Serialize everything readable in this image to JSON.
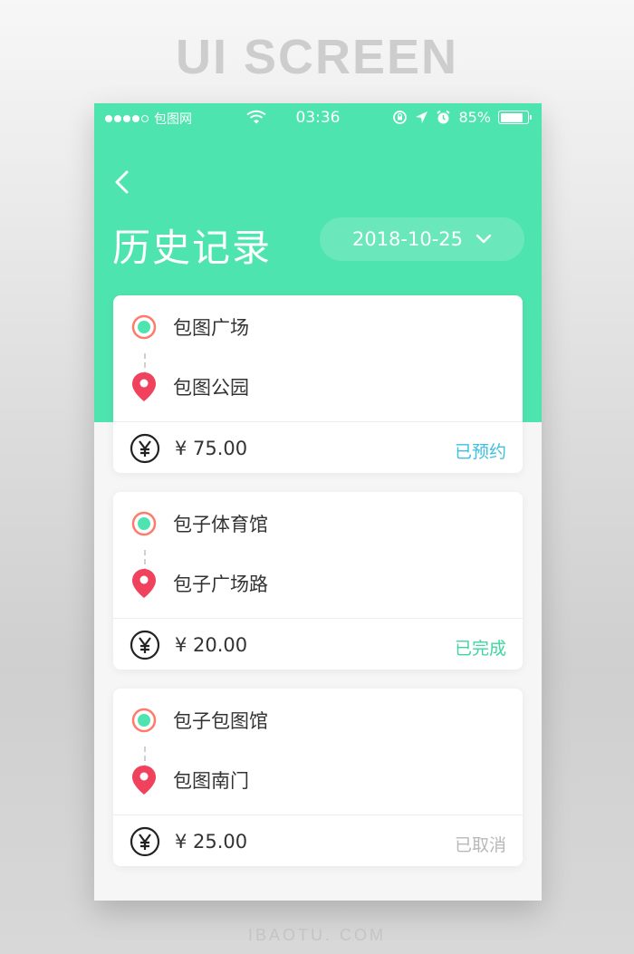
{
  "showcase": {
    "title": "UI SCREEN",
    "footer": "IBAOTU. COM"
  },
  "status_bar": {
    "carrier": "包图网",
    "time": "03:36",
    "battery": "85%",
    "battery_level": 0.85
  },
  "header": {
    "title": "历史记录",
    "date": "2018-10-25"
  },
  "trips": [
    {
      "from": "包图广场",
      "to": "包图公园",
      "price": "¥ 75.00",
      "status": "已预约",
      "status_color": "#3dbfe0"
    },
    {
      "from": "包子体育馆",
      "to": "包子广场路",
      "price": "¥ 20.00",
      "status": "已完成",
      "status_color": "#3fd6a0"
    },
    {
      "from": "包子包图馆",
      "to": "包图南门",
      "price": "¥ 25.00",
      "status": "已取消",
      "status_color": "#b8b8b8"
    }
  ],
  "colors": {
    "accent": "#4ee4b0",
    "start_marker_ring": "#ff7a6a",
    "start_marker_dot": "#4ee4b0",
    "end_marker": "#f0425c"
  }
}
